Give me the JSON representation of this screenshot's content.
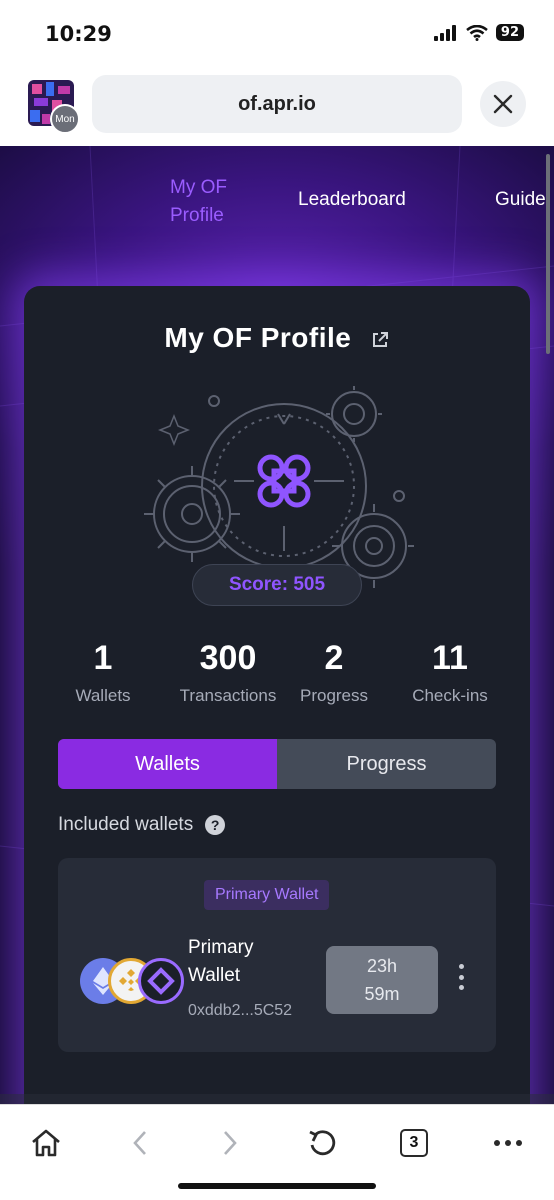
{
  "status_bar": {
    "time": "10:29",
    "battery": "92"
  },
  "browser": {
    "url": "of.apr.io",
    "site_badge": "Mon"
  },
  "nav": {
    "items": [
      "My OF Profile",
      "Leaderboard",
      "Guide"
    ],
    "active": "My OF Profile"
  },
  "profile": {
    "title": "My OF Profile",
    "score": "Score: 505",
    "stats": [
      {
        "value": "1",
        "label": "Wallets"
      },
      {
        "value": "300",
        "label": "Transactions"
      },
      {
        "value": "2",
        "label": "Progress"
      },
      {
        "value": "11",
        "label": "Check-ins"
      }
    ],
    "tabs": [
      "Wallets",
      "Progress"
    ],
    "active_tab": "Wallets",
    "included_label": "Included wallets"
  },
  "wallet": {
    "tag": "Primary Wallet",
    "name": "Primary Wallet",
    "address": "0xddb2...5C52",
    "timer_line1": "23h",
    "timer_line2": "59m",
    "chains": [
      "ethereum-icon",
      "bnb-icon",
      "apro-icon"
    ]
  },
  "toolbar": {
    "tab_count": "3"
  },
  "colors": {
    "accent": "#8a2be2",
    "score": "#8f55ff",
    "card": "#1b1f29"
  }
}
